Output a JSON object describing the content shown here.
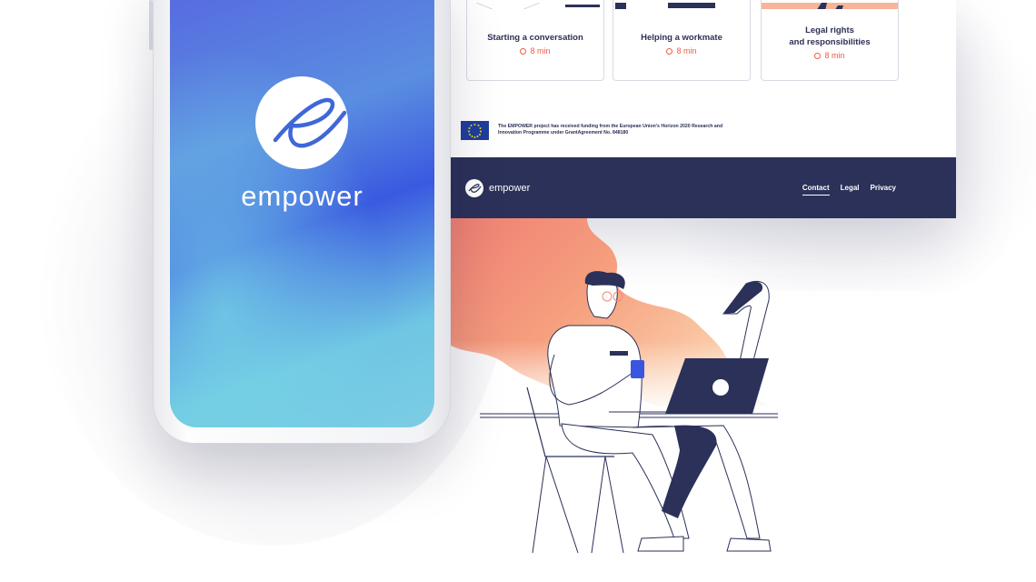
{
  "phone": {
    "app_name": "empower",
    "logo_icon": "empower-e-logo"
  },
  "website": {
    "cards": [
      {
        "title_line1": "Starting a conversation",
        "title_line2": "",
        "duration": "8 min"
      },
      {
        "title_line1": "Helping a workmate",
        "title_line2": "",
        "duration": "8 min"
      },
      {
        "title_line1": "Legal rights",
        "title_line2": "and responsibilities",
        "duration": "8 min"
      }
    ],
    "funding_text": "The EMPOWER project has received funding from the European Union's Horizon 2020 Research and Innovation Programme under GrantAgreement No. 848180",
    "footer": {
      "brand": "empower",
      "links": [
        "Contact",
        "Legal",
        "Privacy"
      ],
      "active_link": "Contact"
    }
  },
  "colors": {
    "navy": "#2b3159",
    "accent_red": "#ef5a46",
    "phone_gradient_top": "#5667e0",
    "phone_gradient_bottom": "#7bcde4",
    "illustration_orange": "#f3907a"
  },
  "icons": [
    "clock-icon",
    "eu-flag-icon",
    "empower-e-logo",
    "person-laptop-illustration"
  ]
}
